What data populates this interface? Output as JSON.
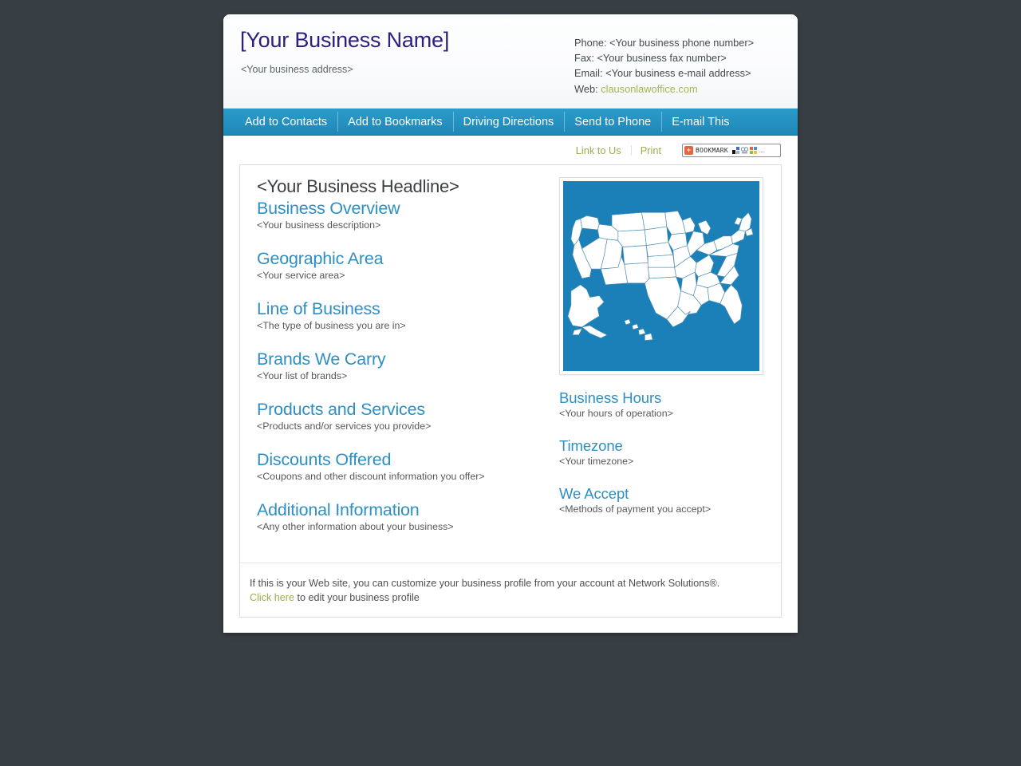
{
  "header": {
    "business_name": "[Your Business Name]",
    "business_address": "<Your business address>",
    "phone_label": "Phone:",
    "phone_value": "<Your business phone number>",
    "fax_label": "Fax:",
    "fax_value": "<Your business fax number>",
    "email_label": "Email:",
    "email_value": "<Your business e-mail address>",
    "web_label": "Web:",
    "web_value": "clausonlawoffice.com",
    "title_color": "#2d2080",
    "link_color": "#a3b752"
  },
  "navbar": {
    "items": [
      {
        "label": "Add to Contacts"
      },
      {
        "label": "Add to Bookmarks"
      },
      {
        "label": "Driving Directions"
      },
      {
        "label": "Send to Phone"
      },
      {
        "label": "E-mail This"
      }
    ],
    "background_color": "#2693c2"
  },
  "utility": {
    "link_to_us": "Link to Us",
    "print": "Print",
    "bookmark_label": "BOOKMARK",
    "bookmark_plus": "+",
    "bookmark_ellipsis": "..."
  },
  "main": {
    "headline": "<Your Business Headline>",
    "sections": [
      {
        "heading": "Business Overview",
        "body": "<Your business description>"
      },
      {
        "heading": "Geographic Area",
        "body": "<Your service area>"
      },
      {
        "heading": "Line of Business",
        "body": "<The type of business you are in>"
      },
      {
        "heading": "Brands We Carry",
        "body": "<Your list of brands>"
      },
      {
        "heading": "Products and Services",
        "body": "<Products and/or services you provide>"
      },
      {
        "heading": "Discounts Offered",
        "body": "<Coupons and other discount information you offer>"
      },
      {
        "heading": "Additional Information",
        "body": "<Any other information about your business>"
      }
    ],
    "heading_color": "#2e8fc4"
  },
  "sidebar": {
    "map_alt": "map-of-united-states",
    "map_background": "#1b80b8",
    "map_land_color": "#ffffff",
    "sections": [
      {
        "heading": "Business Hours",
        "body": "<Your hours of operation>"
      },
      {
        "heading": "Timezone",
        "body": "<Your timezone>"
      },
      {
        "heading": "We Accept",
        "body": "<Methods of payment you accept>"
      }
    ]
  },
  "footer": {
    "line1": "If this is your Web site, you can customize your business profile from your account at Network Solutions®.",
    "link_text": "Click here",
    "line2_rest": " to edit your business profile"
  }
}
